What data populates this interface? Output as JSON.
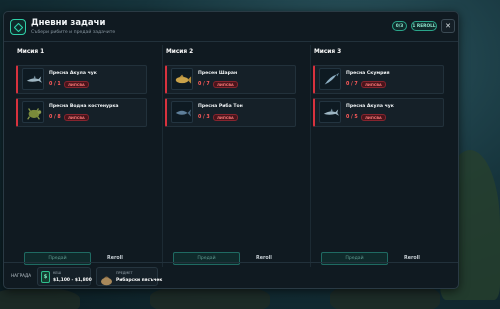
{
  "header": {
    "title": "Дневни задачи",
    "subtitle": "Събери рибите и предай задачите",
    "progress_label": "0/3",
    "rerolls_label": "1 REROLL",
    "close_label": "✕"
  },
  "missions": [
    {
      "title": "Мисия 1",
      "tasks": [
        {
          "name": "Пресна Акула чук",
          "count": "0 / 1",
          "status": "ЛИПСВА",
          "icon": "hammerhead-shark-icon"
        },
        {
          "name": "Пресна Водна костенурка",
          "count": "0 / 8",
          "status": "ЛИПСВА",
          "icon": "turtle-icon"
        }
      ],
      "submit_label": "Предай",
      "reroll_label": "Reroll"
    },
    {
      "title": "Мисия 2",
      "tasks": [
        {
          "name": "Пресен Шаран",
          "count": "0 / 7",
          "status": "ЛИПСВА",
          "icon": "carp-icon"
        },
        {
          "name": "Пресна Риба Тон",
          "count": "0 / 3",
          "status": "ЛИПСВА",
          "icon": "tuna-icon"
        }
      ],
      "submit_label": "Предай",
      "reroll_label": "Reroll"
    },
    {
      "title": "Мисия 3",
      "tasks": [
        {
          "name": "Пресна Скумрия",
          "count": "0 / 7",
          "status": "ЛИПСВА",
          "icon": "mackerel-icon"
        },
        {
          "name": "Пресна Акула чук",
          "count": "0 / 5",
          "status": "ЛИПСВА",
          "icon": "hammerhead-shark-icon"
        }
      ],
      "submit_label": "Предай",
      "reroll_label": "Reroll"
    }
  ],
  "footer": {
    "reward_label": "НАГРАДА",
    "cash": {
      "label": "КЕШ",
      "value": "$1,100 - $1,800",
      "icon_char": "$"
    },
    "item": {
      "label": "ПРЕДМЕТ",
      "value": "Рибарски пясъчек"
    }
  },
  "colors": {
    "accent": "#2fd0a8",
    "missing": "#ff5a5a",
    "panel": "#101a21"
  }
}
